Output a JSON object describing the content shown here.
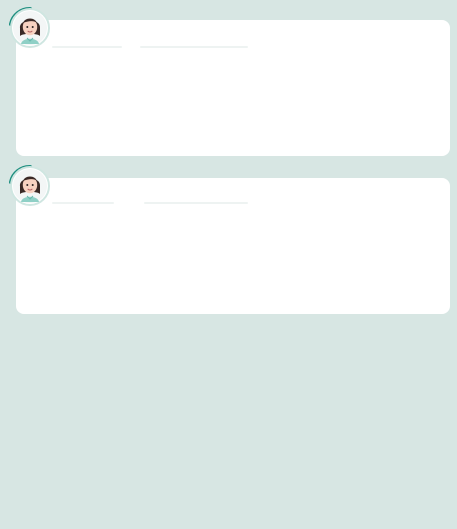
{
  "posts": [
    {
      "id": "post-1",
      "avatar": {
        "icon": "woman-avatar-icon",
        "accent_color": "#1f8f80",
        "ring_color": "#cfe6e1"
      }
    },
    {
      "id": "post-2",
      "avatar": {
        "icon": "woman-avatar-icon",
        "accent_color": "#1f8f80",
        "ring_color": "#cfe6e1"
      }
    }
  ],
  "colors": {
    "background": "#d7e6e3",
    "card": "#ffffff",
    "placeholder": "#eef3f2"
  }
}
